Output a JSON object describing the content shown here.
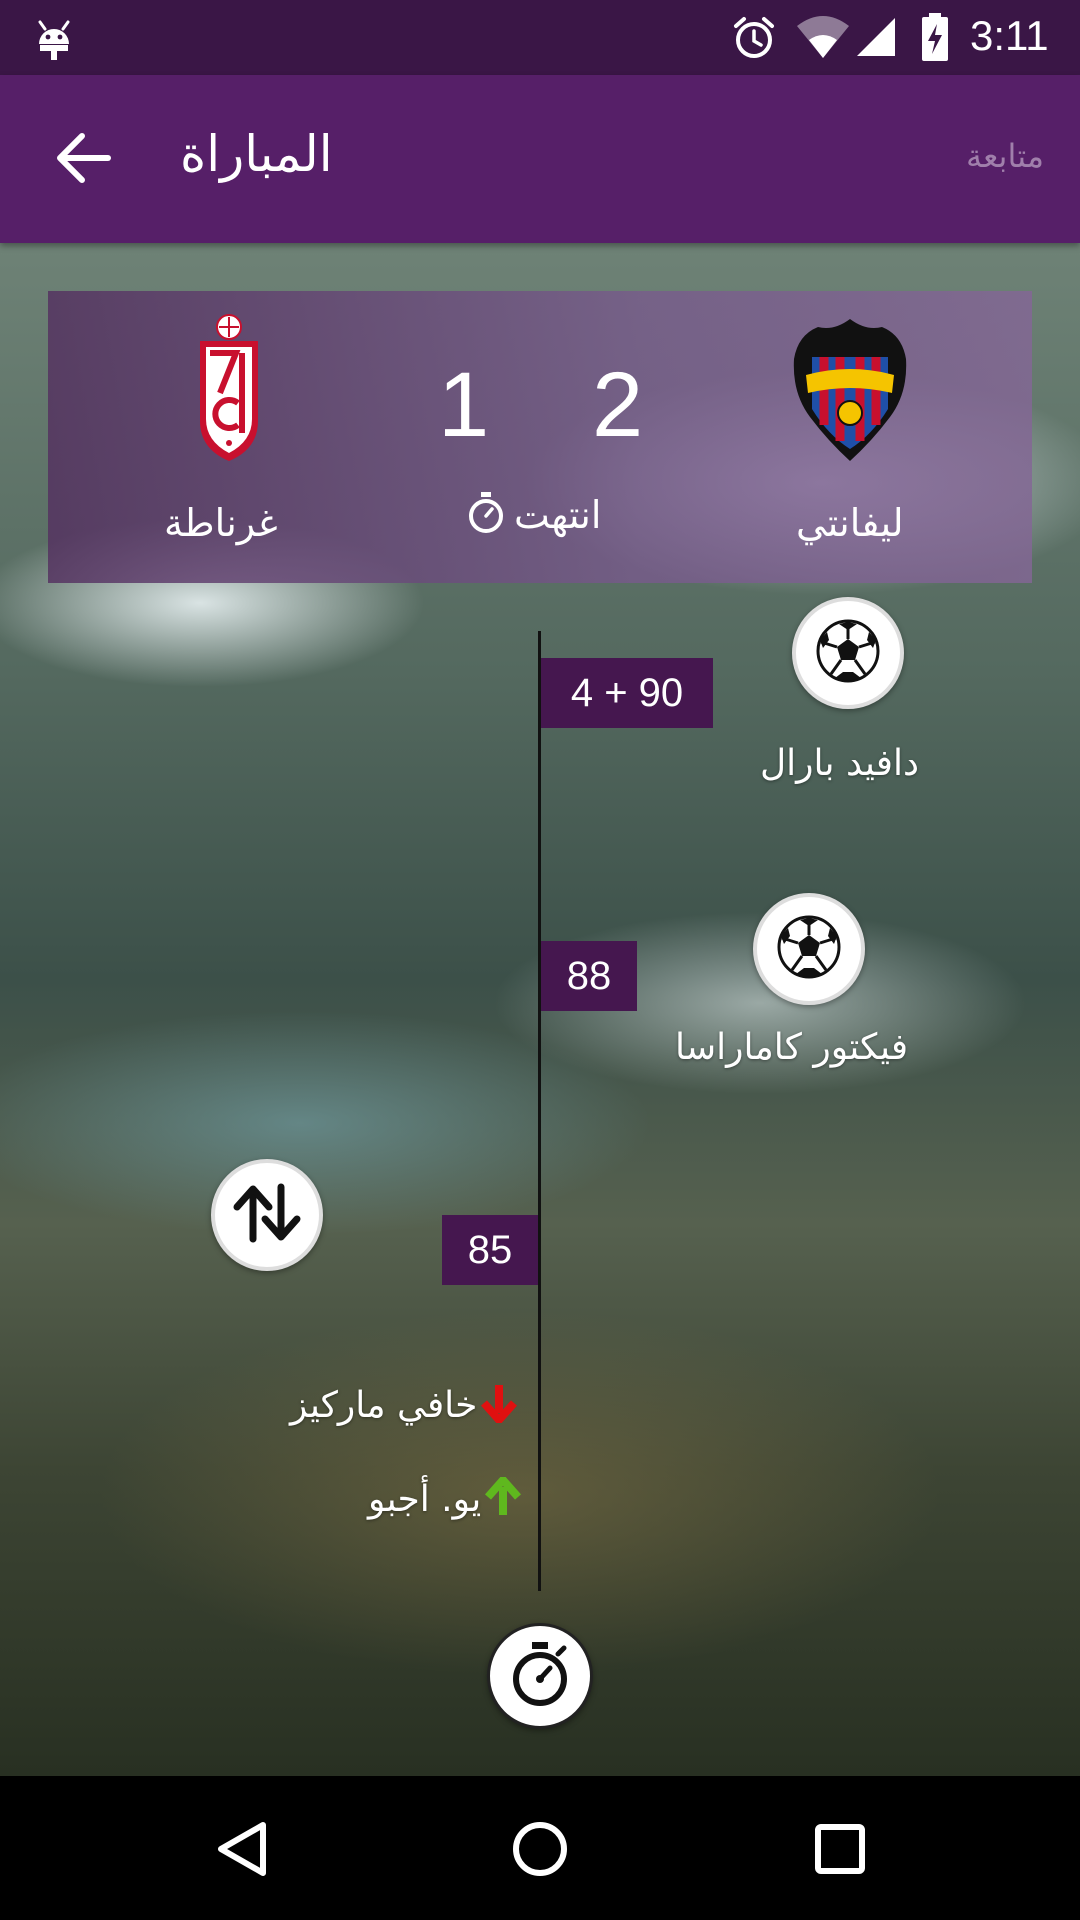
{
  "status_bar": {
    "time": "3:11",
    "icons": [
      "android-icon",
      "alarm-icon",
      "wifi-icon",
      "signal-icon",
      "battery-charging-icon"
    ]
  },
  "app_bar": {
    "title": "المباراة",
    "follow_label": "متابعة",
    "back_icon": "arrow-back-icon"
  },
  "match": {
    "home_team": "ليفانتي",
    "away_team": "غرناطة",
    "home_score": "2",
    "away_score": "1",
    "status": "انتهت",
    "status_icon": "stopwatch-icon",
    "home_logo": "levante-crest",
    "away_logo": "granada-crest"
  },
  "events": [
    {
      "minute": "4 + 90",
      "type": "goal",
      "player": "دافيد بارال",
      "icon": "soccer-ball-icon"
    },
    {
      "minute": "88",
      "type": "goal",
      "player": "فيكتور كاماراسا",
      "icon": "soccer-ball-icon"
    },
    {
      "minute": "85",
      "type": "substitution",
      "player_out": "خافي ماركيز",
      "player_in": "يو. أجبو",
      "icon": "substitution-icon"
    }
  ],
  "timeline_end_icon": "stopwatch-icon",
  "colors": {
    "status_bar": "#3a1646",
    "app_bar": "#561f68",
    "badge": "#45174f",
    "follow_text": "#a07fab",
    "sub_out": "#e01010",
    "sub_in": "#5fb81e"
  },
  "nav_bar": {
    "back_icon": "nav-back-icon",
    "home_icon": "nav-home-icon",
    "recents_icon": "nav-recents-icon"
  }
}
